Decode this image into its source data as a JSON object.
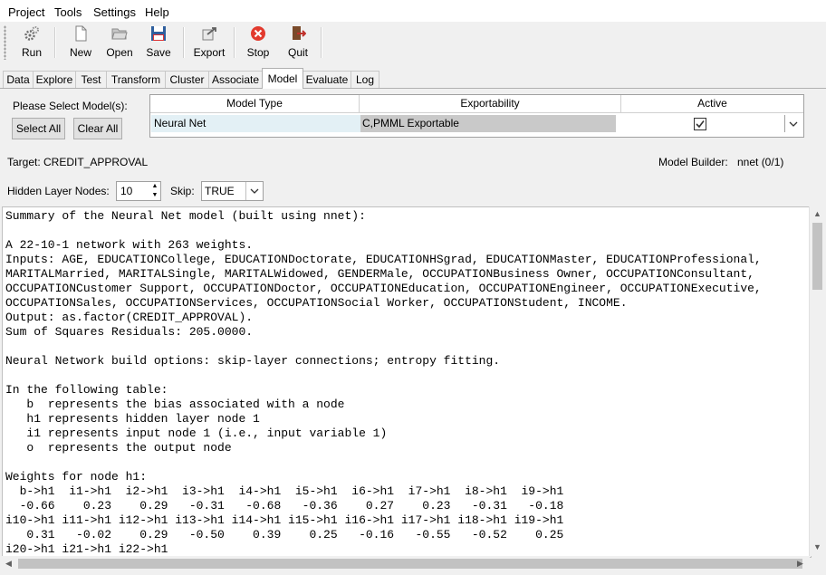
{
  "menu": [
    "Project",
    "Tools",
    "Settings",
    "Help"
  ],
  "toolbar": {
    "run": "Run",
    "new": "New",
    "open": "Open",
    "save": "Save",
    "export": "Export",
    "stop": "Stop",
    "quit": "Quit"
  },
  "tabs": [
    "Data",
    "Explore",
    "Test",
    "Transform",
    "Cluster",
    "Associate",
    "Model",
    "Evaluate",
    "Log"
  ],
  "active_tab": "Model",
  "model_select": {
    "prompt": "Please Select Model(s):",
    "select_all": "Select All",
    "clear_all": "Clear All",
    "columns": [
      "Model Type",
      "Exportability",
      "Active"
    ],
    "row": {
      "model_type": "Neural Net",
      "exportability": "C,PMML Exportable",
      "active": true
    }
  },
  "target": "Target: CREDIT_APPROVAL",
  "model_builder_label": "Model Builder:",
  "model_builder_value": "nnet (0/1)",
  "hidden_layer_label": "Hidden Layer Nodes:",
  "hidden_layer_value": "10",
  "skip_label": "Skip:",
  "skip_value": "TRUE",
  "output_lines": [
    "Summary of the Neural Net model (built using nnet):",
    "",
    "A 22-10-1 network with 263 weights.",
    "Inputs: AGE, EDUCATIONCollege, EDUCATIONDoctorate, EDUCATIONHSgrad, EDUCATIONMaster, EDUCATIONProfessional,",
    "MARITALMarried, MARITALSingle, MARITALWidowed, GENDERMale, OCCUPATIONBusiness Owner, OCCUPATIONConsultant,",
    "OCCUPATIONCustomer Support, OCCUPATIONDoctor, OCCUPATIONEducation, OCCUPATIONEngineer, OCCUPATIONExecutive,",
    "OCCUPATIONSales, OCCUPATIONServices, OCCUPATIONSocial Worker, OCCUPATIONStudent, INCOME.",
    "Output: as.factor(CREDIT_APPROVAL).",
    "Sum of Squares Residuals: 205.0000.",
    "",
    "Neural Network build options: skip-layer connections; entropy fitting.",
    "",
    "In the following table:",
    "   b  represents the bias associated with a node",
    "   h1 represents hidden layer node 1",
    "   i1 represents input node 1 (i.e., input variable 1)",
    "   o  represents the output node",
    "",
    "Weights for node h1:",
    "  b->h1  i1->h1  i2->h1  i3->h1  i4->h1  i5->h1  i6->h1  i7->h1  i8->h1  i9->h1",
    "  -0.66    0.23    0.29   -0.31   -0.68   -0.36    0.27    0.23   -0.31   -0.18",
    "i10->h1 i11->h1 i12->h1 i13->h1 i14->h1 i15->h1 i16->h1 i17->h1 i18->h1 i19->h1",
    "   0.31   -0.02    0.29   -0.50    0.39    0.25   -0.16   -0.55   -0.52    0.25",
    "i20->h1 i21->h1 i22->h1"
  ]
}
